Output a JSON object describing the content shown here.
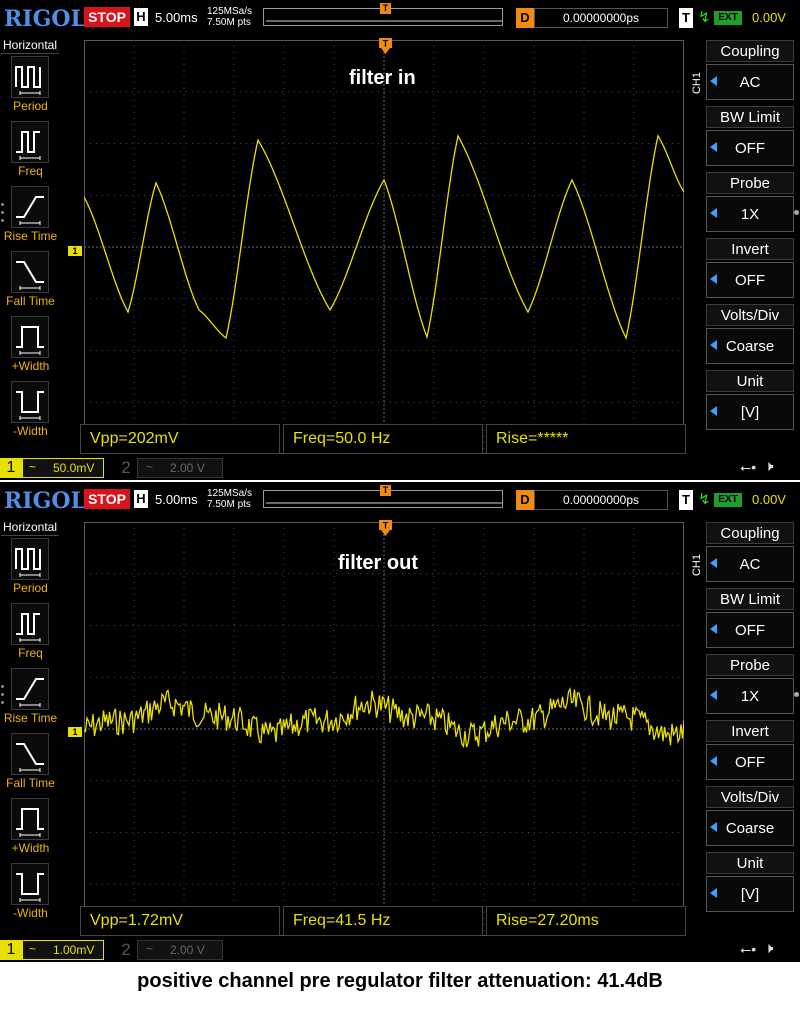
{
  "screens": [
    {
      "topbar": {
        "logo": "RIGOL",
        "run_state": "STOP",
        "h_label": "H",
        "timebase": "5.00ms",
        "sample_rate": "125MSa/s",
        "mem_depth": "7.50M pts",
        "trig_mark_label": "T",
        "d_label": "D",
        "delay": "0.00000000ps",
        "t_label": "T",
        "trig_source": "EXT",
        "trig_level": "0.00V"
      },
      "left_menu": {
        "title": "Horizontal",
        "items": [
          "Period",
          "Freq",
          "Rise Time",
          "Fall Time",
          "+Width",
          "-Width"
        ]
      },
      "grid_label": "filter in",
      "ch1_marker": "1",
      "measurements": [
        "Vpp=202mV",
        "Freq=50.0 Hz",
        "Rise=*****"
      ],
      "right_menu": {
        "channel_tag": "CH1",
        "items": [
          {
            "head": "Coupling",
            "value": "AC"
          },
          {
            "head": "BW Limit",
            "value": "OFF"
          },
          {
            "head": "Probe",
            "value": "1X"
          },
          {
            "head": "Invert",
            "value": "OFF"
          },
          {
            "head": "Volts/Div",
            "value": "Coarse"
          },
          {
            "head": "Unit",
            "value": "[V]"
          }
        ]
      },
      "bottombar": {
        "ch1_num": "1",
        "ch1_coupling": "~",
        "ch1_scale": "50.0mV",
        "ch2_num": "2",
        "ch2_coupling": "~",
        "ch2_scale": "2.00 V"
      },
      "waveform": {
        "type": "sawtooth",
        "cycles_visible": 3
      }
    },
    {
      "topbar": {
        "logo": "RIGOL",
        "run_state": "STOP",
        "h_label": "H",
        "timebase": "5.00ms",
        "sample_rate": "125MSa/s",
        "mem_depth": "7.50M pts",
        "trig_mark_label": "T",
        "d_label": "D",
        "delay": "0.00000000ps",
        "t_label": "T",
        "trig_source": "EXT",
        "trig_level": "0.00V"
      },
      "left_menu": {
        "title": "Horizontal",
        "items": [
          "Period",
          "Freq",
          "Rise Time",
          "Fall Time",
          "+Width",
          "-Width"
        ]
      },
      "grid_label": "filter out",
      "ch1_marker": "1",
      "measurements": [
        "Vpp=1.72mV",
        "Freq=41.5 Hz",
        "Rise=27.20ms"
      ],
      "right_menu": {
        "channel_tag": "CH1",
        "items": [
          {
            "head": "Coupling",
            "value": "AC"
          },
          {
            "head": "BW Limit",
            "value": "OFF"
          },
          {
            "head": "Probe",
            "value": "1X"
          },
          {
            "head": "Invert",
            "value": "OFF"
          },
          {
            "head": "Volts/Div",
            "value": "Coarse"
          },
          {
            "head": "Unit",
            "value": "[V]"
          }
        ]
      },
      "bottombar": {
        "ch1_num": "1",
        "ch1_coupling": "~",
        "ch1_scale": "1.00mV",
        "ch2_num": "2",
        "ch2_coupling": "~",
        "ch2_scale": "2.00 V"
      },
      "waveform": {
        "type": "noise",
        "cycles_visible": 3
      }
    }
  ],
  "caption": "positive channel pre regulator filter attenuation: 41.4dB",
  "colors": {
    "ch1": "#e8e000",
    "brand": "#4f8fe6",
    "stop": "#d8141b",
    "trigger": "#f08a10",
    "ext": "#1e9e2a"
  }
}
